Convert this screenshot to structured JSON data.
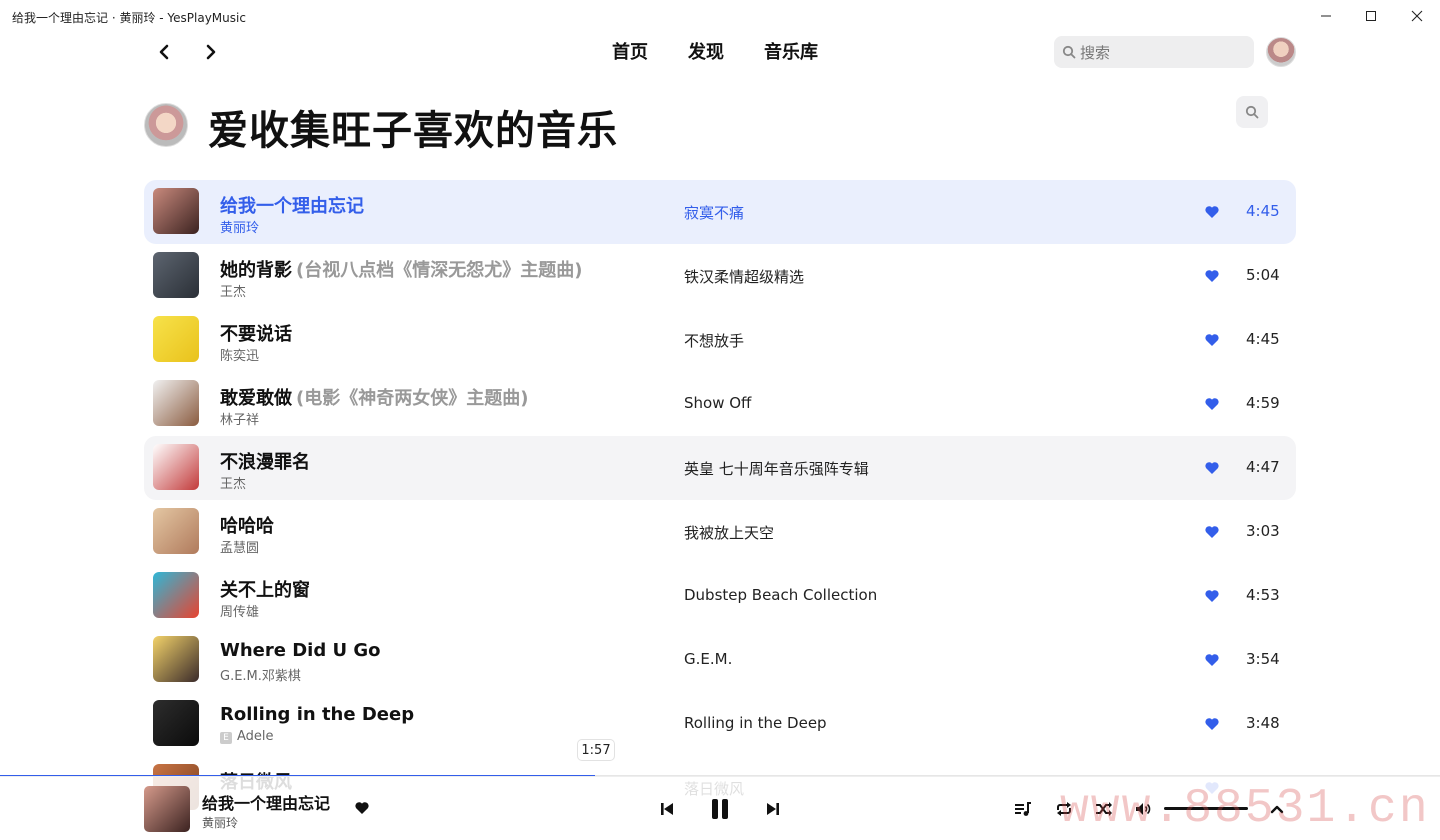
{
  "window": {
    "title": "给我一个理由忘记 · 黄丽玲 - YesPlayMusic"
  },
  "nav": {
    "links": [
      "首页",
      "发现",
      "音乐库"
    ],
    "search_placeholder": "搜索"
  },
  "page": {
    "title": "爱收集旺子喜欢的音乐"
  },
  "colors": {
    "accent": "#335eea",
    "playing_bg": "#eaeffd",
    "hover_bg": "#f4f4f6"
  },
  "tracks": [
    {
      "title": "给我一个理由忘记",
      "subtitle": "",
      "artist": "黄丽玲",
      "album": "寂寞不痛",
      "duration": "4:45",
      "liked": true,
      "state": "playing",
      "cover": [
        "#c98a7d",
        "#3b2220"
      ]
    },
    {
      "title": "她的背影",
      "subtitle": "(台视八点档《情深无怨尤》主题曲)",
      "artist": "王杰",
      "album": "铁汉柔情超级精选",
      "duration": "5:04",
      "liked": true,
      "state": "",
      "cover": [
        "#5d6570",
        "#2a2f36"
      ]
    },
    {
      "title": "不要说话",
      "subtitle": "",
      "artist": "陈奕迅",
      "album": "不想放手",
      "duration": "4:45",
      "liked": true,
      "state": "",
      "cover": [
        "#f7e24a",
        "#e9c21c"
      ]
    },
    {
      "title": "敢爱敢做",
      "subtitle": "(电影《神奇两女侠》主题曲)",
      "artist": "林子祥",
      "album": "Show Off",
      "duration": "4:59",
      "liked": true,
      "state": "",
      "cover": [
        "#f1f1f1",
        "#8a5b3f"
      ]
    },
    {
      "title": "不浪漫罪名",
      "subtitle": "",
      "artist": "王杰",
      "album": "英皇 七十周年音乐强阵专辑",
      "duration": "4:47",
      "liked": true,
      "state": "hover",
      "cover": [
        "#ffffff",
        "#c23a3a"
      ]
    },
    {
      "title": "哈哈哈",
      "subtitle": "",
      "artist": "孟慧圆",
      "album": "我被放上天空",
      "duration": "3:03",
      "liked": true,
      "state": "",
      "cover": [
        "#e4c7a3",
        "#b07a5c"
      ]
    },
    {
      "title": "关不上的窗",
      "subtitle": "",
      "artist": "周传雄",
      "album": "Dubstep Beach Collection",
      "duration": "4:53",
      "liked": true,
      "state": "",
      "cover": [
        "#2fb7d7",
        "#e8432f"
      ]
    },
    {
      "title": "Where Did U Go",
      "subtitle": "",
      "artist": "G.E.M.邓紫棋",
      "album": "G.E.M.",
      "duration": "3:54",
      "liked": true,
      "state": "",
      "cover": [
        "#f3d36a",
        "#3a2a2a"
      ]
    },
    {
      "title": "Rolling in the Deep",
      "subtitle": "",
      "artist": "Adele",
      "explicit": "E",
      "album": "Rolling in the Deep",
      "duration": "3:48",
      "liked": true,
      "state": "",
      "cover": [
        "#2d2d2d",
        "#0b0b0b"
      ]
    },
    {
      "title": "落日微风",
      "subtitle": "",
      "artist": "",
      "album": "落日微风",
      "duration": "",
      "liked": true,
      "state": "",
      "cover": [
        "#c87444",
        "#7a3e1e"
      ]
    }
  ],
  "player": {
    "title": "给我一个理由忘记",
    "artist": "黄丽玲",
    "time_tip": "1:57",
    "progress": 0.413,
    "volume": 1.0
  },
  "watermark": "www.88531.cn"
}
